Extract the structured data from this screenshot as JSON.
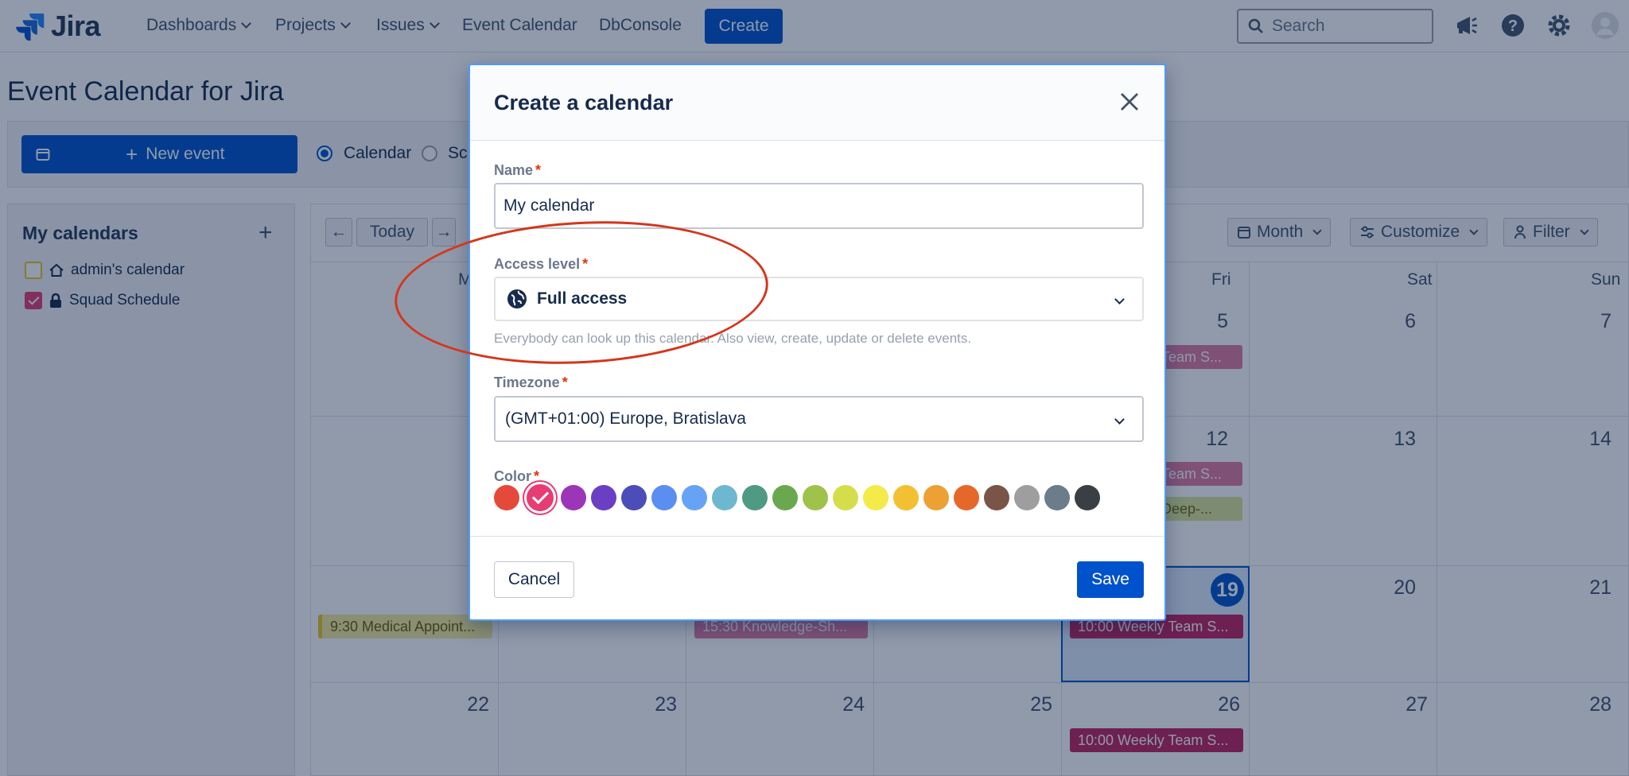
{
  "app": {
    "logo_text": "Jira"
  },
  "nav": {
    "items": [
      "Dashboards",
      "Projects",
      "Issues",
      "Event Calendar",
      "DbConsole"
    ],
    "create_label": "Create",
    "search_placeholder": "Search"
  },
  "page": {
    "title": "Event Calendar for Jira",
    "new_event_label": "New event",
    "view_radio": [
      "Calendar",
      "Sc"
    ]
  },
  "sidebar": {
    "title": "My calendars",
    "calendars": [
      {
        "name": "admin's calendar",
        "checked": false,
        "color": "#ebc61d"
      },
      {
        "name": "Squad Schedule",
        "checked": true,
        "color": "#e53d74"
      }
    ]
  },
  "calendar": {
    "today_label": "Today",
    "month_label": "Month",
    "customize_label": "Customize",
    "filter_label": "Filter",
    "weekdays": [
      "M",
      "Fri",
      "Sat",
      "Sun"
    ],
    "weeks": [
      {
        "days": [
          "5",
          "6",
          "7"
        ]
      },
      {
        "days": [
          "12",
          "13",
          "14"
        ]
      },
      {
        "days": [
          "19",
          "20",
          "21"
        ]
      },
      {
        "days": [
          "22",
          "23",
          "24",
          "25",
          "26",
          "27",
          "28"
        ]
      }
    ],
    "today": "19",
    "events": [
      "Team S...",
      "Team S...",
      "Deep-...",
      "9:30 Medical Appoint...",
      "15:30 Knowledge-Sh...",
      "10:00 Weekly Team S...",
      "10:00 Weekly Team S..."
    ]
  },
  "modal": {
    "title": "Create a calendar",
    "name_label": "Name",
    "name_value": "My calendar",
    "access_label": "Access level",
    "access_value": "Full access",
    "access_help": "Everybody can look up this calendar. Also view, create, update or delete events.",
    "timezone_label": "Timezone",
    "timezone_value": "(GMT+01:00) Europe, Bratislava",
    "color_label": "Color",
    "colors": [
      "#e5493a",
      "#e53d74",
      "#9c35b8",
      "#6b3fc4",
      "#4c4db8",
      "#5a8ef0",
      "#66a3f5",
      "#6db8d0",
      "#4e9a82",
      "#6aa84f",
      "#9fc24a",
      "#d4de4a",
      "#f4ea4a",
      "#f2c031",
      "#eda033",
      "#e6672a",
      "#795548",
      "#9e9e9e",
      "#6b7c8a",
      "#3a3f44"
    ],
    "selected_color": "#e53d74",
    "cancel_label": "Cancel",
    "save_label": "Save",
    "required_mark": "*"
  }
}
